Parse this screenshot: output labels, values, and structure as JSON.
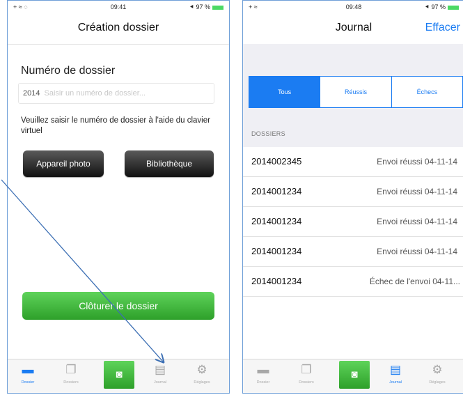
{
  "screen1": {
    "status": {
      "left": "+ ≈ ◌",
      "time": "09:41",
      "right": "⯇ 97 %"
    },
    "nav_title": "Création dossier",
    "field_label": "Numéro de dossier",
    "input_value": "2014",
    "input_placeholder": "Saisir un numéro de dossier...",
    "help_text": "Veuillez saisir le numéro de dossier à l'aide du clavier virtuel",
    "photo_button": "Appareil photo",
    "library_button": "Bibliothèque",
    "close_button": "Clôturer le dossier",
    "tabs": [
      {
        "label": "Dossier",
        "icon": "tray-icon"
      },
      {
        "label": "Dossiers",
        "icon": "pages-icon"
      },
      {
        "label": "",
        "icon": "camera-icon"
      },
      {
        "label": "Journal",
        "icon": "journal-icon"
      },
      {
        "label": "Réglages",
        "icon": "gear-icon"
      }
    ]
  },
  "screen2": {
    "status": {
      "left": "+ ≈",
      "time": "09:48",
      "right": "⯇ 97 %"
    },
    "nav_title": "Journal",
    "nav_action": "Effacer",
    "segments": [
      "Tous",
      "Réussis",
      "Échecs"
    ],
    "section_header": "DOSSIERS",
    "rows": [
      {
        "id": "2014002345",
        "status": "Envoi réussi 04-11-14"
      },
      {
        "id": "2014001234",
        "status": "Envoi réussi 04-11-14"
      },
      {
        "id": "2014001234",
        "status": "Envoi réussi 04-11-14"
      },
      {
        "id": "2014001234",
        "status": "Envoi réussi 04-11-14"
      },
      {
        "id": "2014001234",
        "status": "Échec de l'envoi 04-11..."
      }
    ],
    "tabs": [
      {
        "label": "Dossier",
        "icon": "tray-icon"
      },
      {
        "label": "Dossiers",
        "icon": "pages-icon"
      },
      {
        "label": "",
        "icon": "camera-icon"
      },
      {
        "label": "Journal",
        "icon": "journal-icon"
      },
      {
        "label": "Réglages",
        "icon": "gear-icon"
      }
    ]
  },
  "colors": {
    "accent": "#1b7cf2",
    "green": "#3fb83b",
    "arrow": "#3c6fb4"
  }
}
